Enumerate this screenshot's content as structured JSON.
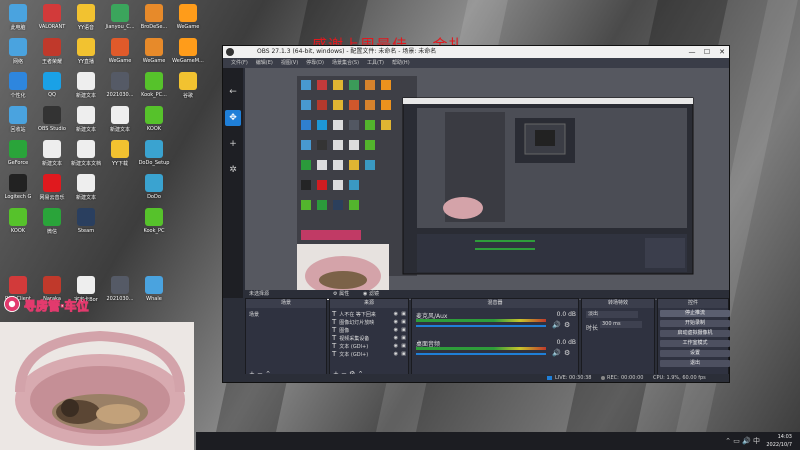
{
  "overlay": {
    "text": "感谢上周最佳．、金扎"
  },
  "obs": {
    "title": "OBS 27.1.3 (64-bit, windows) - 配置文件: 未命名 - 场景: 未命名",
    "menu": [
      "文件(F)",
      "编辑(E)",
      "视图(V)",
      "停靠(D)",
      "场景集合(S)",
      "工具(T)",
      "帮助(H)"
    ],
    "scene_bar": {
      "label": "未选择源",
      "props": "属性",
      "filters": "滤镜"
    },
    "docks": {
      "scenes": {
        "title": "场景",
        "items": [
          "场景"
        ]
      },
      "sources": {
        "title": "来源",
        "items": [
          "人不在 等下回来",
          "图像幻灯片放映",
          "图像",
          "视频采集设备",
          "文本 (GDI+)",
          "文本 (GDI+)"
        ]
      },
      "mixer": {
        "title": "混音器",
        "channels": [
          {
            "name": "麦克风/Aux",
            "db": "0.0 dB"
          },
          {
            "name": "桌面音频",
            "db": "0.0 dB"
          }
        ]
      },
      "transitions": {
        "title": "转场特效",
        "type": "淡出",
        "duration_label": "时长",
        "duration": "300 ms"
      },
      "controls": {
        "title": "控件",
        "buttons": [
          "停止推流",
          "开始录制",
          "启动虚拟摄像机",
          "工作室模式",
          "设置",
          "退出"
        ]
      }
    },
    "status": {
      "live_label": "LIVE:",
      "live": "00:30:38",
      "rec_label": "REC:",
      "rec": "00:00:00",
      "cpu": "CPU: 1.9%, 60.00 fps"
    }
  },
  "desktop": {
    "icons": [
      {
        "label": "此电脑",
        "color": "#4aa3df"
      },
      {
        "label": "VALORANT",
        "color": "#d23a3a"
      },
      {
        "label": "YY语音",
        "color": "#f2c230"
      },
      {
        "label": "Jianyou_C...",
        "color": "#3ba55c"
      },
      {
        "label": "BroDeSe...",
        "color": "#e78a2a"
      },
      {
        "label": "WeGame",
        "color": "#ff9c1a"
      },
      {
        "label": "网络",
        "color": "#4aa3df"
      },
      {
        "label": "王者荣耀",
        "color": "#c0392b"
      },
      {
        "label": "YY直播",
        "color": "#f2c230"
      },
      {
        "label": "WeGame",
        "color": "#e05a2a"
      },
      {
        "label": "WeGame",
        "color": "#e78a2a"
      },
      {
        "label": "WeGameM...",
        "color": "#ff9c1a"
      },
      {
        "label": "个性化",
        "color": "#2e86de"
      },
      {
        "label": "QQ",
        "color": "#1aa1e6"
      },
      {
        "label": "新建文本",
        "color": "#eeeeee"
      },
      {
        "label": "2021030...",
        "color": "#555a66"
      },
      {
        "label": "Kook_PC...",
        "color": "#56c22b"
      },
      {
        "label": "谷歌",
        "color": "#f2c230"
      },
      {
        "label": "回收站",
        "color": "#4aa3df"
      },
      {
        "label": "OBS Studio",
        "color": "#333333"
      },
      {
        "label": "新建文本",
        "color": "#eeeeee"
      },
      {
        "label": "新建文本",
        "color": "#eeeeee"
      },
      {
        "label": "KOOK",
        "color": "#56c22b"
      },
      {
        "label": "GeForce",
        "color": "#2aa43a"
      },
      {
        "label": "新建文本",
        "color": "#eeeeee"
      },
      {
        "label": "新建文本文档",
        "color": "#eeeeee"
      },
      {
        "label": "YY下载",
        "color": "#f2c230"
      },
      {
        "label": "DoDo_Setup",
        "color": "#3aa3d0"
      },
      {
        "label": "Logitech G",
        "color": "#222222"
      },
      {
        "label": "网易云音乐",
        "color": "#e0191e"
      },
      {
        "label": "新建文本",
        "color": "#eeeeee"
      },
      {
        "label": "DoDo",
        "color": "#3aa3d0"
      },
      {
        "label": "KOOK",
        "color": "#56c22b"
      },
      {
        "label": "微信",
        "color": "#2aa43a"
      },
      {
        "label": "Steam",
        "color": "#2a3f5f"
      },
      {
        "label": "Kook_PC",
        "color": "#56c22b"
      },
      {
        "label": "Riot Client",
        "color": "#d23a3a"
      },
      {
        "label": "Naraka",
        "color": "#c0392b"
      },
      {
        "label": "宇宙卡Bor",
        "color": "#eeeeee"
      },
      {
        "label": "2021030...",
        "color": "#555a66"
      },
      {
        "label": "Whale",
        "color": "#4aa3df"
      }
    ],
    "banner": "寻房管·车位"
  },
  "taskbar": {
    "time": "14:03",
    "date": "2022/10/7"
  }
}
